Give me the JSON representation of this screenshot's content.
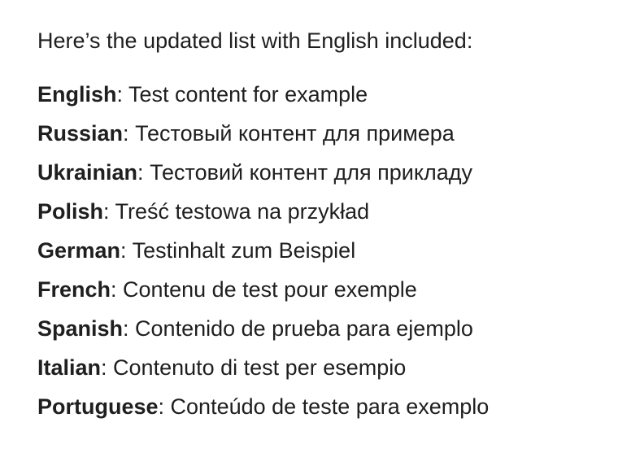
{
  "message": {
    "intro": "Here’s the updated list with English included:",
    "separator": ": ",
    "languages": [
      {
        "name": "English",
        "text": "Test content for example"
      },
      {
        "name": "Russian",
        "text": "Тестовый контент для примера"
      },
      {
        "name": "Ukrainian",
        "text": "Тестовий контент для прикладу"
      },
      {
        "name": "Polish",
        "text": "Treść testowa na przykład"
      },
      {
        "name": "German",
        "text": "Testinhalt zum Beispiel"
      },
      {
        "name": "French",
        "text": "Contenu de test pour exemple"
      },
      {
        "name": "Spanish",
        "text": "Contenido de prueba para ejemplo"
      },
      {
        "name": "Italian",
        "text": "Contenuto di test per esempio"
      },
      {
        "name": "Portuguese",
        "text": "Conteúdo de teste para exemplo"
      }
    ]
  }
}
